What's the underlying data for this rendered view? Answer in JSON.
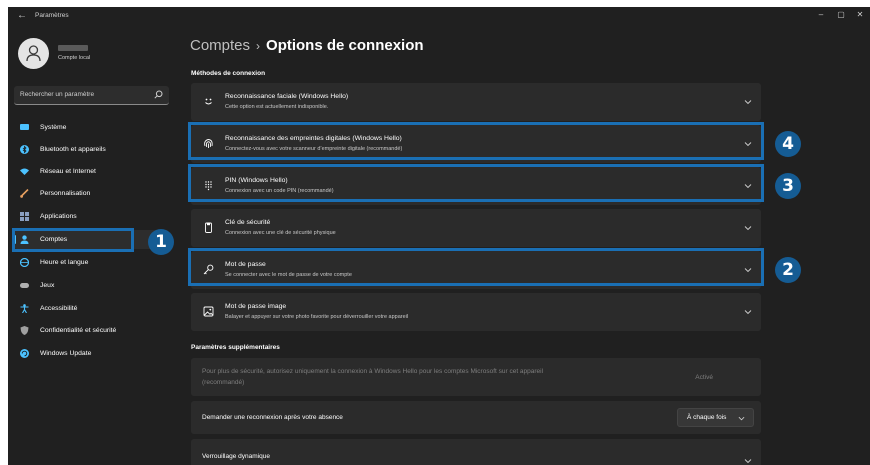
{
  "window": {
    "title": "Paramètres"
  },
  "profile": {
    "account_type": "Compte local"
  },
  "search": {
    "placeholder": "Rechercher un paramètre"
  },
  "sidebar": {
    "items": [
      {
        "label": "Système",
        "icon": "system-icon",
        "color": "#4cc2ff"
      },
      {
        "label": "Bluetooth et appareils",
        "icon": "bluetooth-icon",
        "color": "#4cc2ff"
      },
      {
        "label": "Réseau et Internet",
        "icon": "network-icon",
        "color": "#4cc2ff"
      },
      {
        "label": "Personnalisation",
        "icon": "brush-icon",
        "color": "#e8a060"
      },
      {
        "label": "Applications",
        "icon": "apps-icon",
        "color": "#8a9fc0"
      },
      {
        "label": "Comptes",
        "icon": "account-icon",
        "color": "#4cc2ff",
        "active": true
      },
      {
        "label": "Heure et langue",
        "icon": "globe-icon",
        "color": "#4cc2ff"
      },
      {
        "label": "Jeux",
        "icon": "gamepad-icon",
        "color": "#b0b0b0"
      },
      {
        "label": "Accessibilité",
        "icon": "accessibility-icon",
        "color": "#4cc2ff"
      },
      {
        "label": "Confidentialité et sécurité",
        "icon": "shield-icon",
        "color": "#a0a0a0"
      },
      {
        "label": "Windows Update",
        "icon": "update-icon",
        "color": "#4cc2ff"
      }
    ]
  },
  "breadcrumb": {
    "parent": "Comptes",
    "separator": "›",
    "current": "Options de connexion"
  },
  "methods": {
    "heading": "Méthodes de connexion",
    "items": [
      {
        "title": "Reconnaissance faciale (Windows Hello)",
        "desc": "Cette option est actuellement indisponible.",
        "icon": "face-icon"
      },
      {
        "title": "Reconnaissance des empreintes digitales (Windows Hello)",
        "desc": "Connectez-vous avec votre scanneur d’empreinte digitale (recommandé)",
        "icon": "fingerprint-icon"
      },
      {
        "title": "PIN (Windows Hello)",
        "desc": "Connexion avec un code PIN (recommandé)",
        "icon": "pin-keypad-icon"
      },
      {
        "title": "Clé de sécurité",
        "desc": "Connexion avec une clé de sécurité physique",
        "icon": "security-key-icon"
      },
      {
        "title": "Mot de passe",
        "desc": "Se connecter avec le mot de passe de votre compte",
        "icon": "key-icon"
      },
      {
        "title": "Mot de passe image",
        "desc": "Balayer et appuyer sur votre photo favorite pour déverrouiller votre appareil",
        "icon": "picture-icon"
      }
    ]
  },
  "additional": {
    "heading": "Paramètres supplémentaires",
    "hello_only_text_line1": "Pour plus de sécurité, autorisez uniquement la connexion à Windows Hello pour les comptes Microsoft sur cet appareil",
    "hello_only_text_line2": "(recommandé)",
    "hello_only_value": "Activé",
    "reconnect_label": "Demander une reconnexion après votre absence",
    "reconnect_value": "À chaque fois",
    "dynamic_lock_label": "Verrouillage dynamique"
  },
  "callouts": {
    "comptes": "1",
    "password": "2",
    "pin": "3",
    "fingerprint": "4"
  },
  "colors": {
    "accent": "#4cc2ff",
    "callout": "#155c94",
    "highlight": "#1a6fb4"
  }
}
